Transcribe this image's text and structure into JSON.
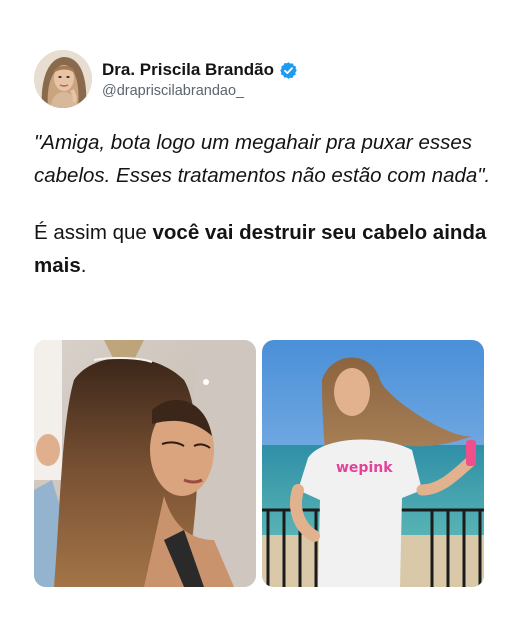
{
  "author": {
    "display_name": "Dra. Priscila Brandão",
    "handle": "@drapriscilabrandao_",
    "verified": true,
    "verified_icon": "verified-badge-icon",
    "badge_color": "#1d9bf0"
  },
  "tweet": {
    "quote": "\"Amiga, bota logo um megahair pra puxar esses cabelos. Esses tratamentos não estão com nada\".",
    "statement_start": "É assim que ",
    "statement_bold": "você vai destruir seu cabelo ainda mais",
    "statement_end": "."
  },
  "media": {
    "photo_right_shirt_text": "wepink"
  }
}
